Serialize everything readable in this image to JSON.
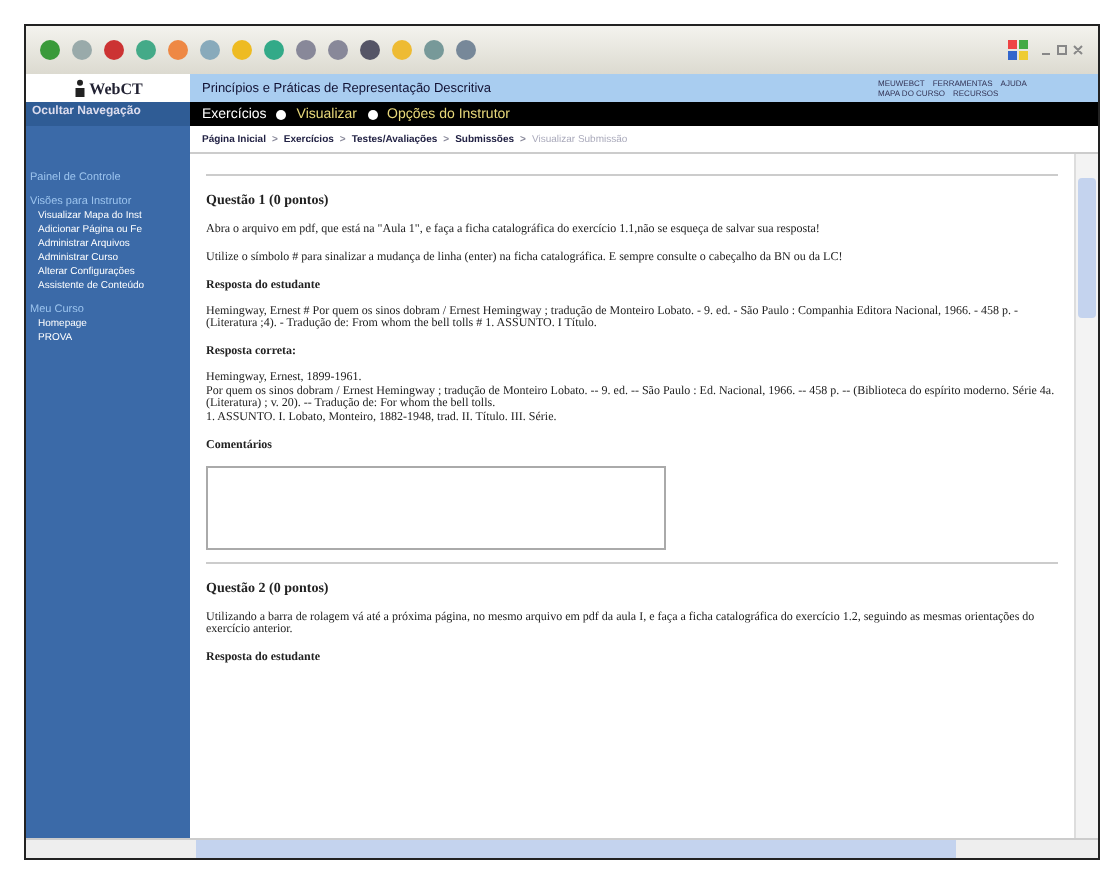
{
  "header": {
    "logo": "WebCT",
    "title": "Princípios e Práticas de Representação Descritiva",
    "links": [
      "MEUWEBCT",
      "FERRAMENTAS",
      "AJUDA",
      "MAPA DO CURSO",
      "RECURSOS"
    ]
  },
  "hide_nav": "Ocultar Navegação",
  "tool_tabs": [
    {
      "label": "Exercícios",
      "selected": true
    },
    {
      "label": "Visualizar",
      "selected": false
    },
    {
      "label": "Opções do Instrutor",
      "selected": false
    }
  ],
  "breadcrumb": [
    {
      "label": "Página Inicial",
      "current": false
    },
    {
      "separator": ">",
      "label": "Exercícios",
      "current": false
    },
    {
      "separator": ">",
      "label": "Testes/Avaliações",
      "current": false
    },
    {
      "separator": ">",
      "label": "Submissões",
      "current": false
    },
    {
      "separator": ">",
      "label": "Visualizar Submissão",
      "current": true
    }
  ],
  "sidebar": [
    {
      "heading": "Painel de Controle"
    },
    {
      "heading": "Visões para Instrutor",
      "items": [
        "Visualizar Mapa do Inst",
        "Adicionar Página ou Fe",
        "Administrar Arquivos",
        "Administrar Curso",
        "Alterar Configurações",
        "Assistente de Conteúdo"
      ]
    },
    {
      "heading": "Meu Curso",
      "items": [
        "Homepage",
        "PROVA"
      ]
    }
  ],
  "questions": [
    {
      "title": "Questão 1  (0 pontos)",
      "prompts": [
        "Abra o arquivo em pdf, que está na \"Aula 1\", e faça a ficha catalográfica do exercício 1.1,não se esqueça de salvar sua resposta!",
        "Utilize o símbolo # para sinalizar a mudança de linha (enter) na ficha catalográfica. E sempre consulte o cabeçalho da BN ou da LC!"
      ],
      "sections": [
        {
          "heading": "Resposta do estudante",
          "lines": [
            "Hemingway, Ernest # Por quem os sinos dobram / Ernest Hemingway ; tradução de Monteiro Lobato. - 9. ed. - São Paulo : Companhia Editora Nacional, 1966. - 458 p. - (Literatura ;4). - Tradução de: From whom the bell tolls # 1. ASSUNTO. I Título."
          ]
        },
        {
          "heading": "Resposta correta:",
          "lines": [
            "Hemingway, Ernest, 1899-1961.",
            "Por quem os sinos dobram / Ernest Hemingway ; tradução de Monteiro Lobato. -- 9. ed. -- São Paulo : Ed. Nacional, 1966. -- 458 p. -- (Biblioteca do espírito moderno. Série 4a. (Literatura) ; v. 20). -- Tradução de: For whom the bell tolls.",
            "1. ASSUNTO. I. Lobato, Monteiro, 1882-1948, trad. II. Título. III. Série."
          ]
        }
      ],
      "comment_label": "Comentários"
    },
    {
      "title": "Questão 2  (0 pontos)",
      "prompts": [
        "Utilizando a barra de rolagem vá até a próxima página, no mesmo arquivo em pdf da aula I, e faça a ficha catalográfica do exercício 1.2, seguindo as mesmas orientações do exercício anterior."
      ],
      "sections": [
        {
          "heading": "Resposta do estudante"
        }
      ]
    }
  ]
}
